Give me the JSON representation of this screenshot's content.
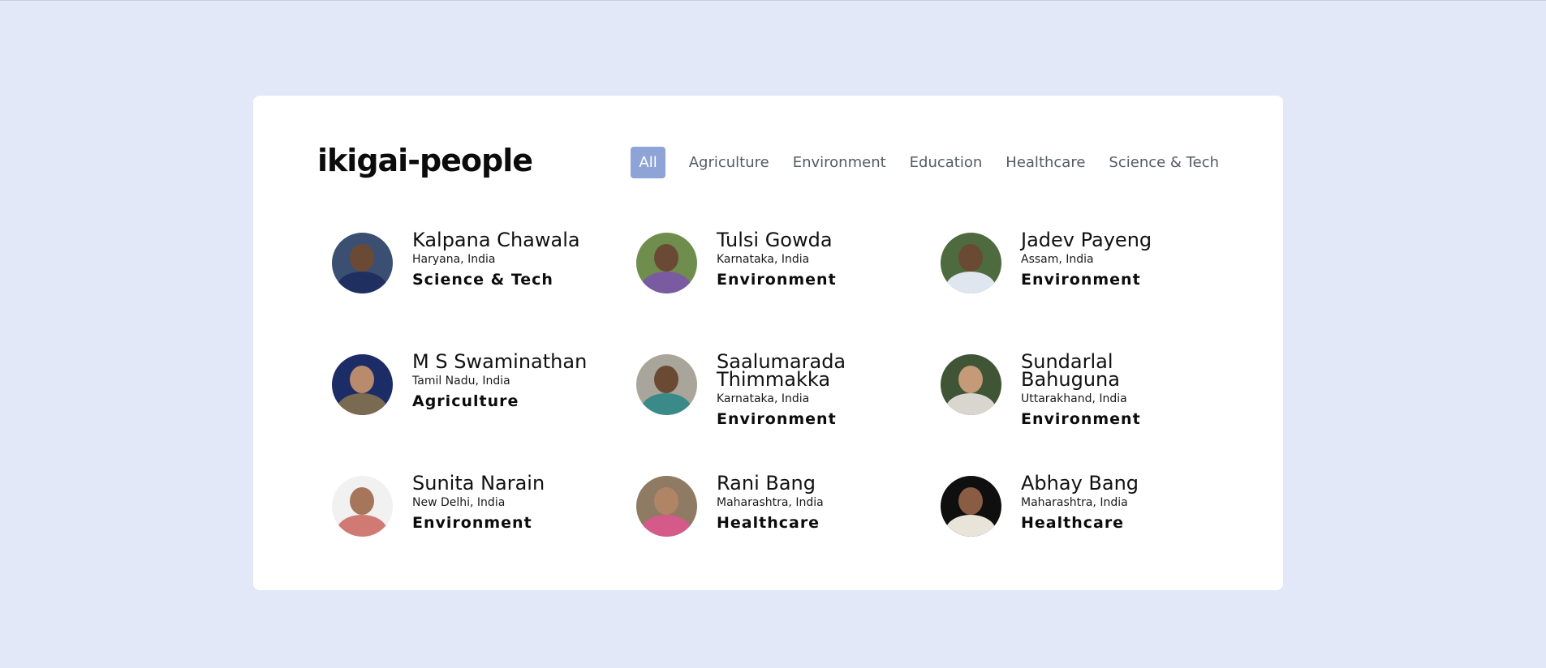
{
  "brand": "ikigai-people",
  "tabs": [
    {
      "label": "All",
      "active": true
    },
    {
      "label": "Agriculture",
      "active": false
    },
    {
      "label": "Environment",
      "active": false
    },
    {
      "label": "Education",
      "active": false
    },
    {
      "label": "Healthcare",
      "active": false
    },
    {
      "label": "Science & Tech",
      "active": false
    }
  ],
  "people": [
    {
      "name": "Kalpana Chawala",
      "location": "Haryana, India",
      "category": "Science & Tech",
      "avatar_colors": {
        "bg": "#3b4f73",
        "head": "#6b4a35",
        "body": "#1f2f60"
      }
    },
    {
      "name": "Tulsi Gowda",
      "location": "Karnataka, India",
      "category": "Environment",
      "avatar_colors": {
        "bg": "#6f8d4c",
        "head": "#6b4a35",
        "body": "#7a5aa0"
      }
    },
    {
      "name": "Jadev Payeng",
      "location": "Assam, India",
      "category": "Environment",
      "avatar_colors": {
        "bg": "#4d6b3e",
        "head": "#6a4a33",
        "body": "#dfe6ef"
      }
    },
    {
      "name": "M S Swaminathan",
      "location": "Tamil Nadu, India",
      "category": "Agriculture",
      "avatar_colors": {
        "bg": "#1c2c66",
        "head": "#b98a6c",
        "body": "#7a6a52"
      }
    },
    {
      "name": "Saalumarada Thimmakka",
      "location": "Karnataka, India",
      "category": "Environment",
      "avatar_colors": {
        "bg": "#a9a59a",
        "head": "#6b4a33",
        "body": "#3a8a8a"
      }
    },
    {
      "name": "Sundarlal Bahuguna",
      "location": "Uttarakhand, India",
      "category": "Environment",
      "avatar_colors": {
        "bg": "#3f5536",
        "head": "#c49a78",
        "body": "#d9d6cf"
      }
    },
    {
      "name": "Sunita Narain",
      "location": "New Delhi, India",
      "category": "Environment",
      "avatar_colors": {
        "bg": "#f1f1f1",
        "head": "#a57659",
        "body": "#d07a74"
      }
    },
    {
      "name": "Rani Bang",
      "location": "Maharashtra, India",
      "category": "Healthcare",
      "avatar_colors": {
        "bg": "#8f7a63",
        "head": "#b08566",
        "body": "#d45a8a"
      }
    },
    {
      "name": "Abhay Bang",
      "location": "Maharashtra, India",
      "category": "Healthcare",
      "avatar_colors": {
        "bg": "#0f0f0f",
        "head": "#8a5c43",
        "body": "#e8e4da"
      }
    }
  ]
}
